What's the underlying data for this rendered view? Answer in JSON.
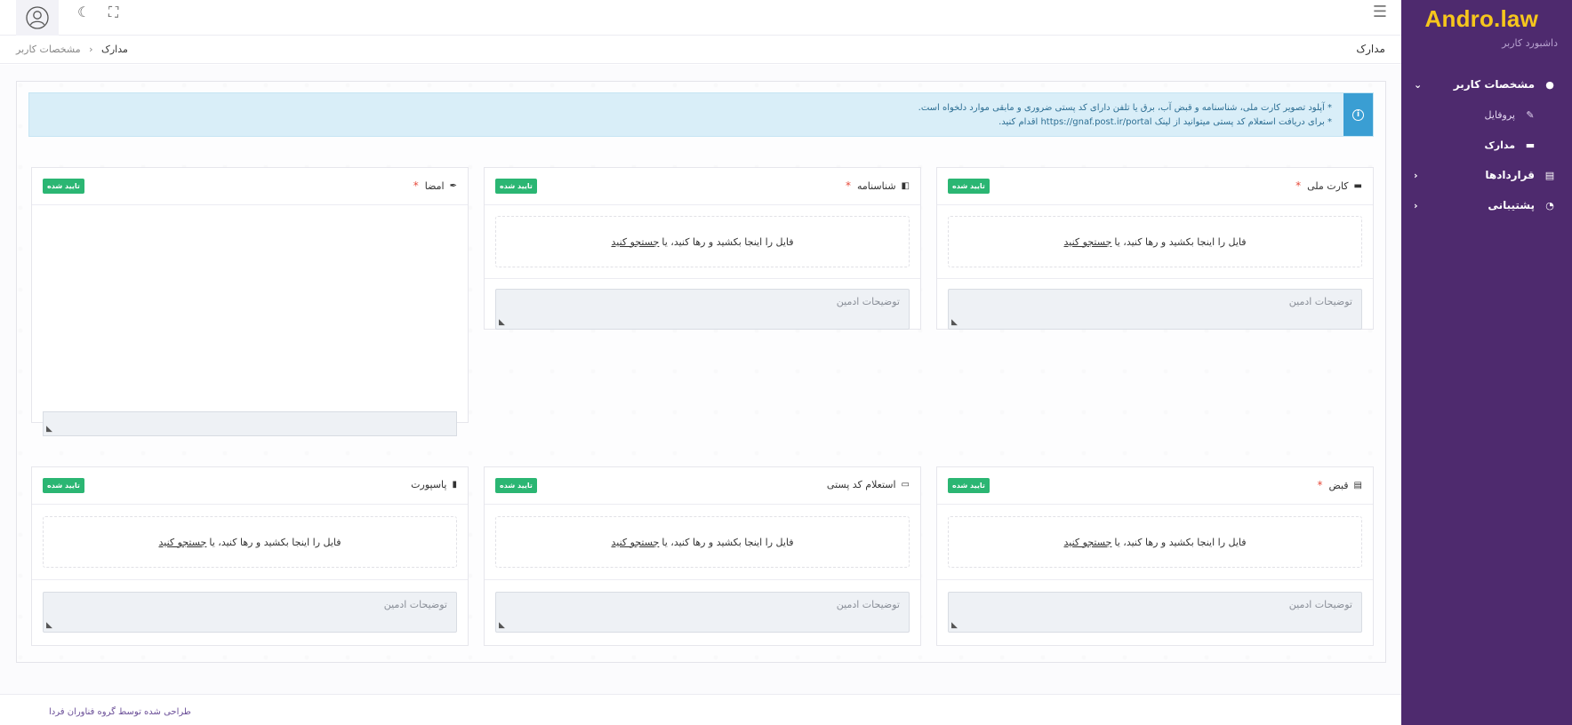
{
  "brand": {
    "name": "Andro.law",
    "subtitle": "داشبورد کاربر"
  },
  "nav": {
    "user_specs": "مشخصات کاربر",
    "profile": "پروفایل",
    "documents": "مدارک",
    "contracts": "قراردادها",
    "support": "پشتیبانی"
  },
  "header": {
    "title": "مدارک"
  },
  "breadcrumb": {
    "current": "مدارک",
    "sep": "‹",
    "parent": "مشخصات کاربر"
  },
  "alert": {
    "line1": "* آپلود تصویر کارت ملی، شناسنامه و قبض آب، برق یا تلفن دارای کد پستی ضروری و مابقی موارد دلخواه است.",
    "line2": "* برای دریافت استعلام کد پستی میتوانید از لینک https://gnaf.post.ir/portal اقدام کنید."
  },
  "common": {
    "approved": "تایید شده",
    "drop_text": "فایل را اینجا بکشید و رها کنید، یا",
    "browse": "جستجو کنید",
    "admin_notes": "توضیحات ادمین",
    "required_mark": "*"
  },
  "cards": {
    "national_card": "کارت ملی",
    "birth_cert": "شناسنامه",
    "signature": "امضا",
    "bill": "قبض",
    "postal_code": "استعلام کد پستی",
    "passport": "پاسپورت"
  },
  "footer": {
    "text": "طراحی شده توسط گروه فناوران فردا"
  }
}
